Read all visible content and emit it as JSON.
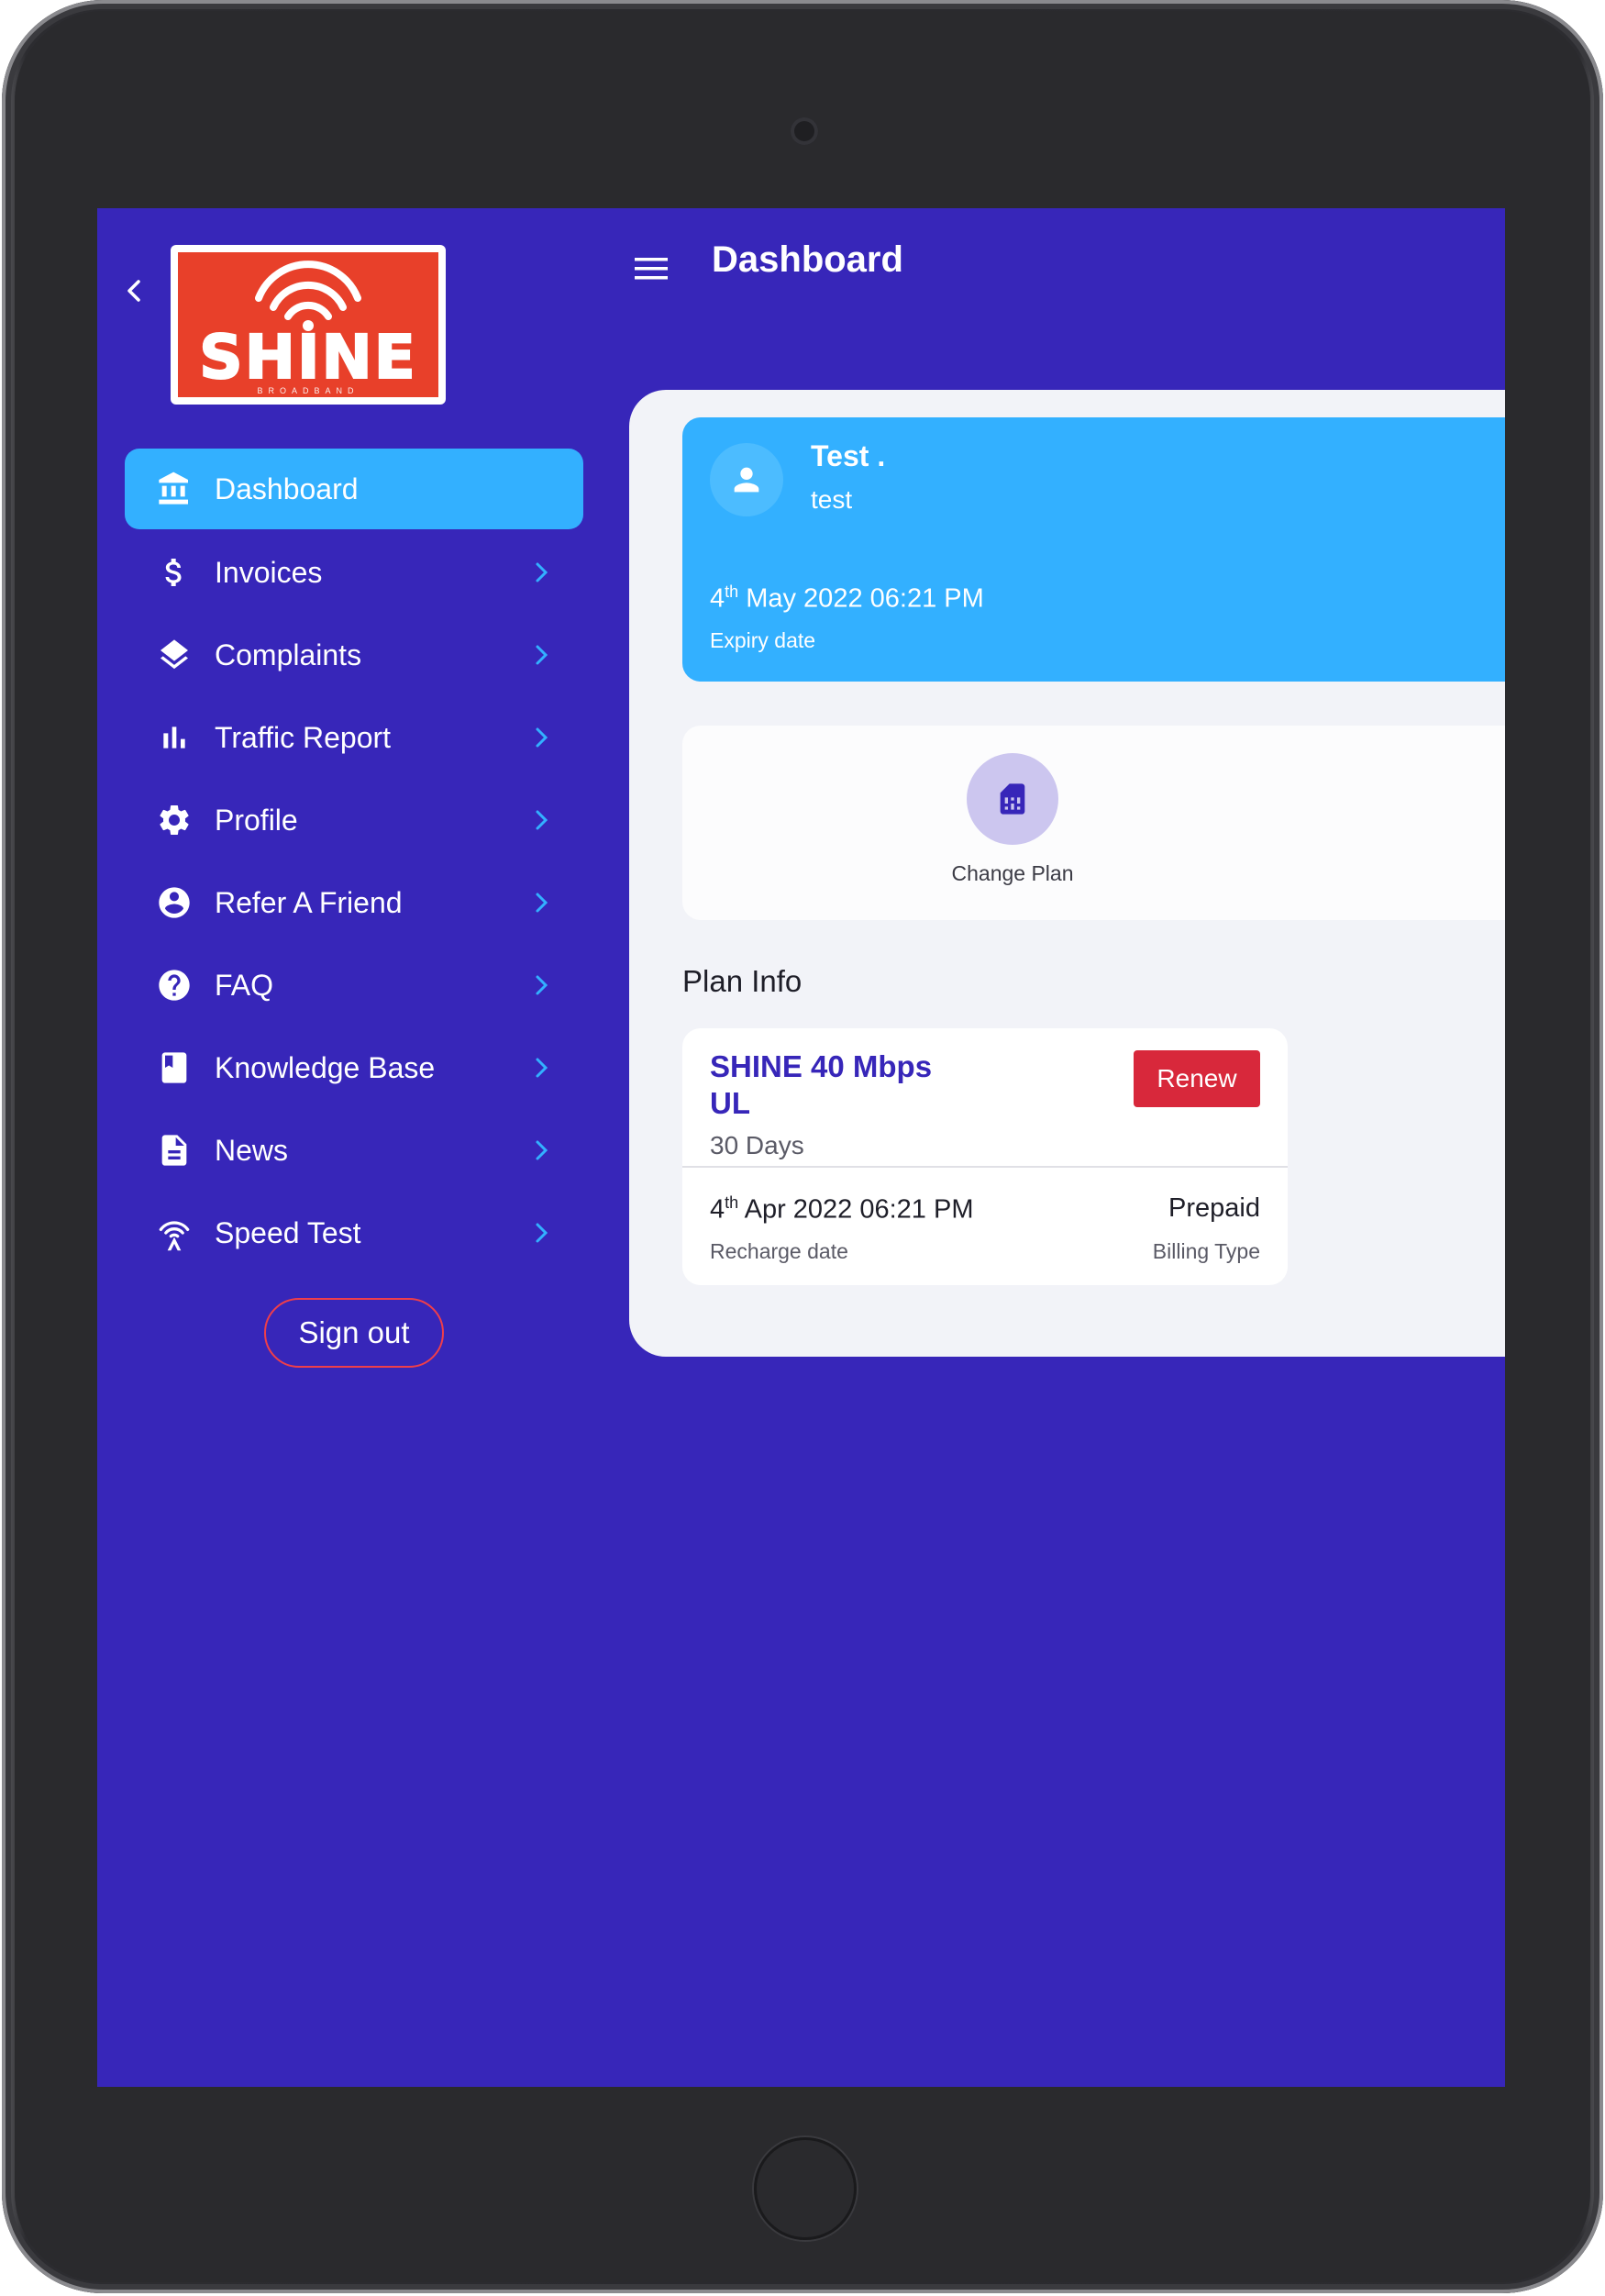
{
  "header": {
    "title": "Dashboard"
  },
  "logo": {
    "text": "SHINE",
    "subtext": "BROADBAND"
  },
  "sidebar": {
    "items": [
      {
        "label": "Dashboard",
        "icon": "bank-icon",
        "active": true
      },
      {
        "label": "Invoices",
        "icon": "dollar-icon"
      },
      {
        "label": "Complaints",
        "icon": "layers-icon"
      },
      {
        "label": "Traffic Report",
        "icon": "bar-chart-icon"
      },
      {
        "label": "Profile",
        "icon": "gear-icon"
      },
      {
        "label": "Refer A Friend",
        "icon": "account-circle-icon"
      },
      {
        "label": "FAQ",
        "icon": "help-circle-icon"
      },
      {
        "label": "Knowledge Base",
        "icon": "book-icon"
      },
      {
        "label": "News",
        "icon": "article-icon"
      },
      {
        "label": "Speed Test",
        "icon": "wifi-tower-icon"
      }
    ],
    "signout_label": "Sign out"
  },
  "user_card": {
    "name": "Test .",
    "username": "test",
    "expiry_day": "4",
    "expiry_suffix": "th",
    "expiry_rest": " May 2022 06:21 PM",
    "expiry_label": "Expiry date"
  },
  "actions": {
    "change_plan_label": "Change Plan"
  },
  "plan_info": {
    "heading": "Plan Info",
    "plan_name": "SHINE 40 Mbps UL",
    "duration": "30 Days",
    "renew_label": "Renew",
    "recharge_day": "4",
    "recharge_suffix": "th",
    "recharge_rest": " Apr 2022 06:21 PM",
    "recharge_label": "Recharge date",
    "billing_type": "Prepaid",
    "billing_label": "Billing Type"
  },
  "colors": {
    "background": "#3726b9",
    "accent": "#33b0ff",
    "danger": "#d8283b",
    "brand": "#e8402a"
  }
}
